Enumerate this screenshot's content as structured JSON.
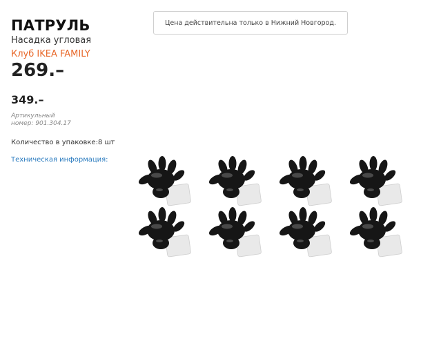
{
  "product": {
    "name": "ПАТРУЛЬ",
    "description": "Насадка угловая",
    "family_label": "Клуб IKEA FAMILY",
    "family_price": "269.–",
    "regular_price": "349.–",
    "article_label": "Артикульный",
    "article_number": "номер: 901.304.17",
    "pack_quantity": "Количество в упаковке:8 шт",
    "tech_info_link": "Техническая информация:"
  },
  "notice": {
    "text": "Цена действительна только в Нижний Новгород."
  },
  "image": {
    "icon": "corner-bumper-icon",
    "count": 8
  },
  "colors": {
    "accent": "#e8692b",
    "link": "#2a7bbf",
    "product_fill": "#161616"
  }
}
